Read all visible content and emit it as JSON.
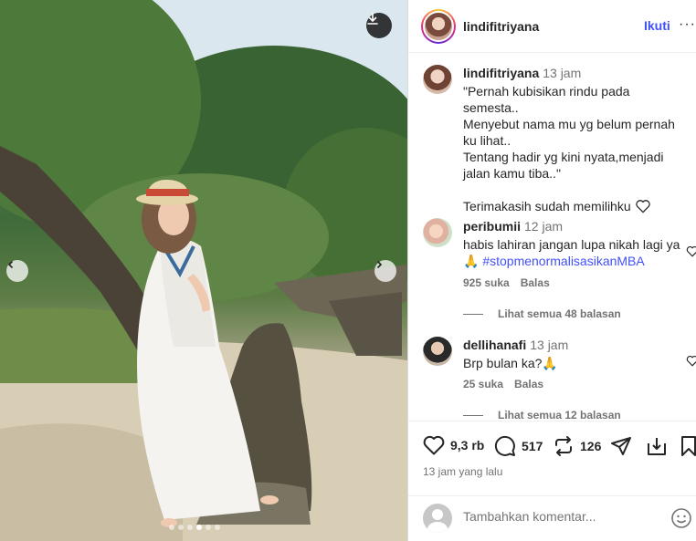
{
  "post": {
    "username": "lindifitriyana",
    "follow_label": "Ikuti",
    "more_label": "···",
    "caption": {
      "username": "lindifitriyana",
      "time": "13 jam",
      "text": "\"Pernah kubisikan rindu pada semesta..\nMenyebut nama mu yg belum pernah ku lihat..\nTentang hadir yg kini nyata,menjadi jalan kamu tiba..\"",
      "thanks": "Terimakasih sudah memilihku"
    },
    "comments": [
      {
        "username": "peribumii",
        "time": "12 jam",
        "text": "habis lahiran jangan lupa nikah lagi ya 🙏",
        "hashtag": "#stopmenormalisasikanMBA",
        "likes": "925 suka",
        "reply_label": "Balas",
        "view_replies": "Lihat semua 48 balasan"
      },
      {
        "username": "dellihanafi",
        "time": "13 jam",
        "text": "Brp bulan ka?🙏",
        "likes": "25 suka",
        "reply_label": "Balas",
        "view_replies": "Lihat semua 12 balasan"
      }
    ],
    "stats": {
      "likes": "9,3 rb",
      "comments": "517",
      "reposts": "126"
    },
    "posted_ago": "13 jam yang lalu",
    "add_comment_placeholder": "Tambahkan komentar...",
    "carousel": {
      "total": 6,
      "active_index": 3
    }
  },
  "icons": {
    "download": "download-icon",
    "prev": "chevron-left-icon",
    "next": "chevron-right-icon",
    "heart": "heart-icon",
    "comment": "comment-icon",
    "repost": "repost-icon",
    "share": "send-icon",
    "save": "bookmark-icon",
    "emoji": "emoji-icon"
  },
  "colors": {
    "accent": "#4150f7",
    "muted": "#737373",
    "text": "#262626"
  }
}
